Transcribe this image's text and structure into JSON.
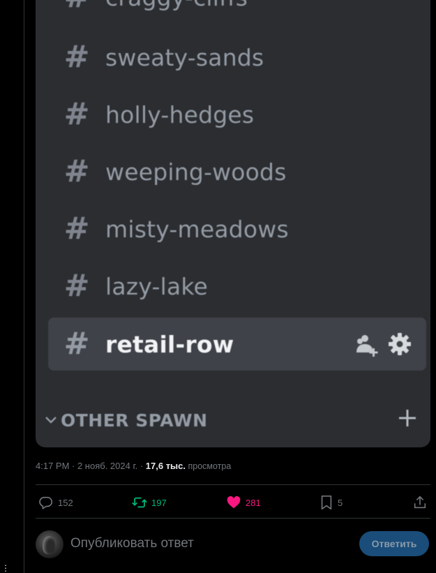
{
  "discord": {
    "channels": [
      {
        "hash": "#",
        "name": "craggy-cliffs"
      },
      {
        "hash": "#",
        "name": "sweaty-sands"
      },
      {
        "hash": "#",
        "name": "holly-hedges"
      },
      {
        "hash": "#",
        "name": "weeping-woods"
      },
      {
        "hash": "#",
        "name": "misty-meadows"
      },
      {
        "hash": "#",
        "name": "lazy-lake"
      },
      {
        "hash": "#",
        "name": "retail-row"
      }
    ],
    "active_channel": "retail-row",
    "category": "OTHER SPAWN"
  },
  "tweet": {
    "timestamp": "4:17 PM · 2 нояб. 2024 г. · ",
    "views_count": "17,6 тыс.",
    "views_label": " просмотра",
    "actions": {
      "replies": "152",
      "reposts": "197",
      "likes": "281",
      "bookmarks": "5"
    },
    "reply_placeholder": "Опубликовать ответ",
    "reply_button": "Ответить"
  },
  "colors": {
    "background": "#000000",
    "discord_panel": "#2b2d31",
    "active_channel_bg": "#404249",
    "repost_active": "#00ba7c",
    "like_active": "#f91880",
    "reply_button": "#1d9bf0"
  },
  "icons": [
    "hash-icon",
    "add-member-icon",
    "gear-icon",
    "chevron-down-icon",
    "plus-icon",
    "reply-icon",
    "repost-icon",
    "heart-icon",
    "bookmark-icon",
    "share-icon",
    "more-dots-icon"
  ]
}
